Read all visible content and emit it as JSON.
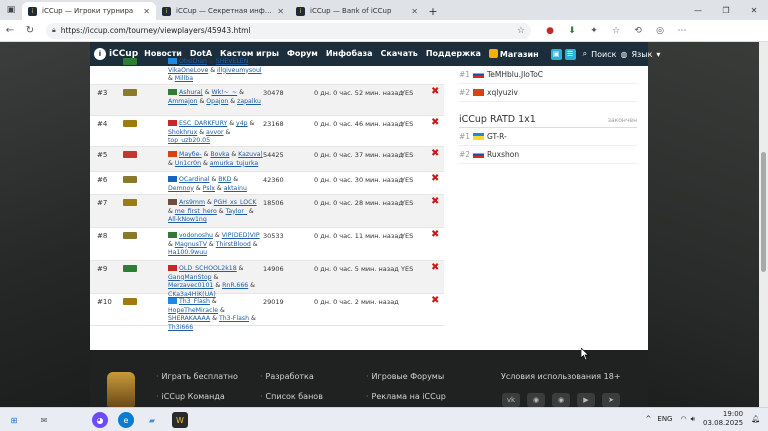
{
  "browser": {
    "tabs": [
      {
        "title": "iCCup — Игроки турнира",
        "active": true
      },
      {
        "title": "iCCup — Секретная информаци…",
        "active": false
      },
      {
        "title": "iCCup — Bank of iCCup",
        "active": false
      }
    ],
    "url": "https://iccup.com/tourney/viewplayers/45943.html"
  },
  "site": {
    "logo": "iCCup",
    "menu": [
      "Новости",
      "DotA",
      "Кастом игры",
      "Форум",
      "Инфобаза",
      "Скачать",
      "Поддержка",
      "Магазин"
    ],
    "search_label": "Поиск",
    "lang_label": "Язык"
  },
  "teams": [
    {
      "num": "",
      "flag_color": "#2e7d32",
      "players_html": "<a>ObsiDian</a> & <a>SHEVELEN</a> & <a>VikaOneLove</a> & <a>illgiveumysoul</a> & <a>Millba</a>",
      "mmr": "",
      "time": "",
      "confirmed": "",
      "partial": true
    },
    {
      "num": "#3",
      "flag_color": "#8a7a2a",
      "players_html": "<a>Ashura|</a> & <a>Wk!~_~</a> & <a>Ammajon</a> & <a>Opajon</a> & <a>zapalku</a>",
      "mmr": "30478",
      "time": "0 дн. 0 час. 52 мин. назад",
      "confirmed": "YES"
    },
    {
      "num": "#4",
      "flag_color": "#a07a10",
      "players_html": "<a>ESC_DARKFURY</a> & <a>y4p</a> & <a>Shokhrux</a> & <a>avvor</a> & <a>top_uzb20.05</a>",
      "mmr": "23168",
      "time": "0 дн. 0 час. 46 мин. назад",
      "confirmed": "YES"
    },
    {
      "num": "#5",
      "flag_color": "#c0392b",
      "players_html": "<a>Mayбe-</a> & <a>Bovka</a> & <a>Kazuva|</a> & <a>Un1cr0n</a> & <a>amurka_tujurka</a>",
      "mmr": "54425",
      "time": "0 дн. 0 час. 37 мин. назад",
      "confirmed": "YES"
    },
    {
      "num": "#6",
      "flag_color": "#8a7a2a",
      "players_html": "<a>OCardinal</a> & <a>BKD</a> & <a>Demnoy</a> & <a>Pslx</a> & <a>aktainu</a>",
      "mmr": "42360",
      "time": "0 дн. 0 час. 30 мин. назад",
      "confirmed": "YES"
    },
    {
      "num": "#7",
      "flag_color": "#a07a10",
      "players_html": "<a>Ars9mm</a> & <a>PGH_xs_LOCK</a> & <a>me_first_hero</a> & <a>Taylor_</a> & <a>All-kNow1ng</a>",
      "mmr": "18506",
      "time": "0 дн. 0 час. 28 мин. назад",
      "confirmed": "YES"
    },
    {
      "num": "#8",
      "flag_color": "#8a7a2a",
      "players_html": "<a>vodonoshu</a> & <a>VIP(DED)VIP</a> & <a>MagnusTV</a> & <a>ThirstBlood</a> & <a>Ha100.9wuu</a>",
      "mmr": "30533",
      "time": "0 дн. 0 час. 11 мин. назад",
      "confirmed": "YES"
    },
    {
      "num": "#9",
      "flag_color": "#2e7d32",
      "players_html": "<a>OLD_SCHOOL2k18</a> & <a>GangManStop</a> & <a>Merzavec0101</a> & <a>RnR.666</a> & <a>CKa3a4HiK(UA)</a>",
      "mmr": "14906",
      "time": "0 дн. 0 час. 5 мин. назад",
      "confirmed": "YES"
    },
    {
      "num": "#10",
      "flag_color": "#a07a10",
      "players_html": "<a>Th3_Flash</a> & <a>HopeTheMiracle</a> & <a>SHERAKAAAA</a> & <a>Th3-Flash</a> & <a>Th3i666</a>",
      "mmr": "29019",
      "time": "0 дн. 0 час. 2 мин. назад",
      "confirmed": "",
      "no_yes": true
    }
  ],
  "ranking": {
    "top_rows": [
      {
        "rank": "#1",
        "name": "TeMHblu.JloToC"
      },
      {
        "rank": "#2",
        "name": "xqlyuziv"
      }
    ],
    "section_title": "iCCup RATD 1x1",
    "section_status": "закончен",
    "rows": [
      {
        "rank": "#1",
        "name": "GT-R-"
      },
      {
        "rank": "#2",
        "name": "Ruxshon"
      }
    ]
  },
  "footer": {
    "col1": [
      "Играть бесплатно",
      "iCCup Команда"
    ],
    "col2": [
      "Разработка",
      "Список банов"
    ],
    "col3": [
      "Игровые Форумы",
      "Реклама на iCCup"
    ],
    "terms": "Условия использования 18+"
  },
  "taskbar": {
    "lang": "ENG",
    "time": "19:00",
    "date": "03.08.2025"
  }
}
